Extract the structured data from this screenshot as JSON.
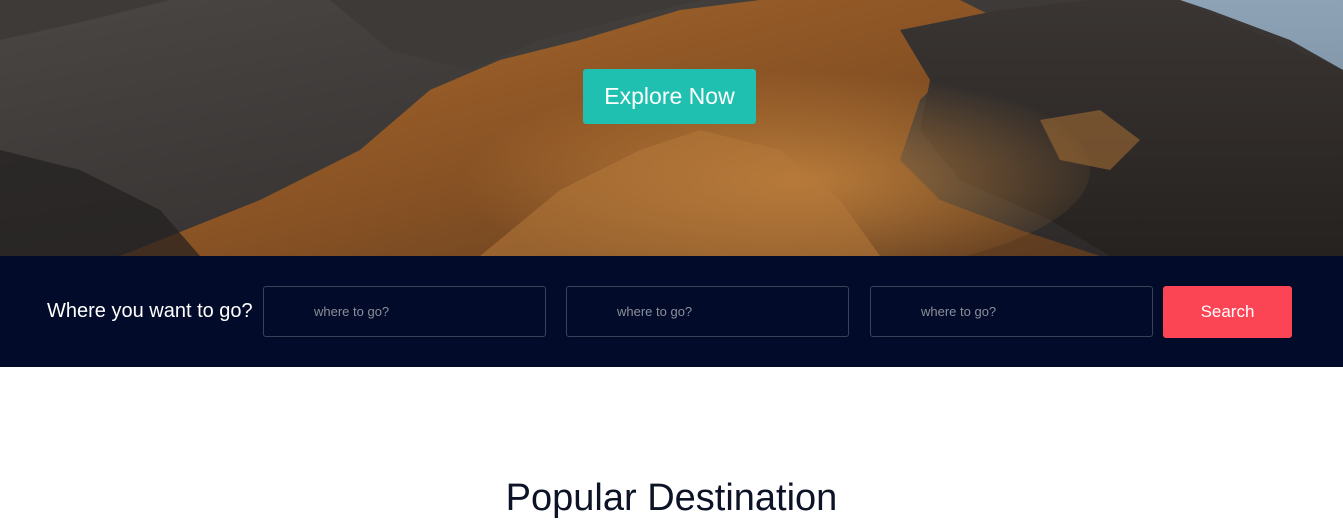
{
  "hero": {
    "explore_button": "Explore Now"
  },
  "search": {
    "label": "Where you want to go?",
    "fields": [
      {
        "placeholder": "where to go?",
        "value": ""
      },
      {
        "placeholder": "where to go?",
        "value": ""
      },
      {
        "placeholder": "where to go?",
        "value": ""
      }
    ],
    "button": "Search"
  },
  "section": {
    "title": "Popular Destination"
  },
  "colors": {
    "accent": "#1fc0b0",
    "search_button": "#fb4454",
    "search_bar_bg": "#020b29",
    "title_text": "#0c1327"
  }
}
